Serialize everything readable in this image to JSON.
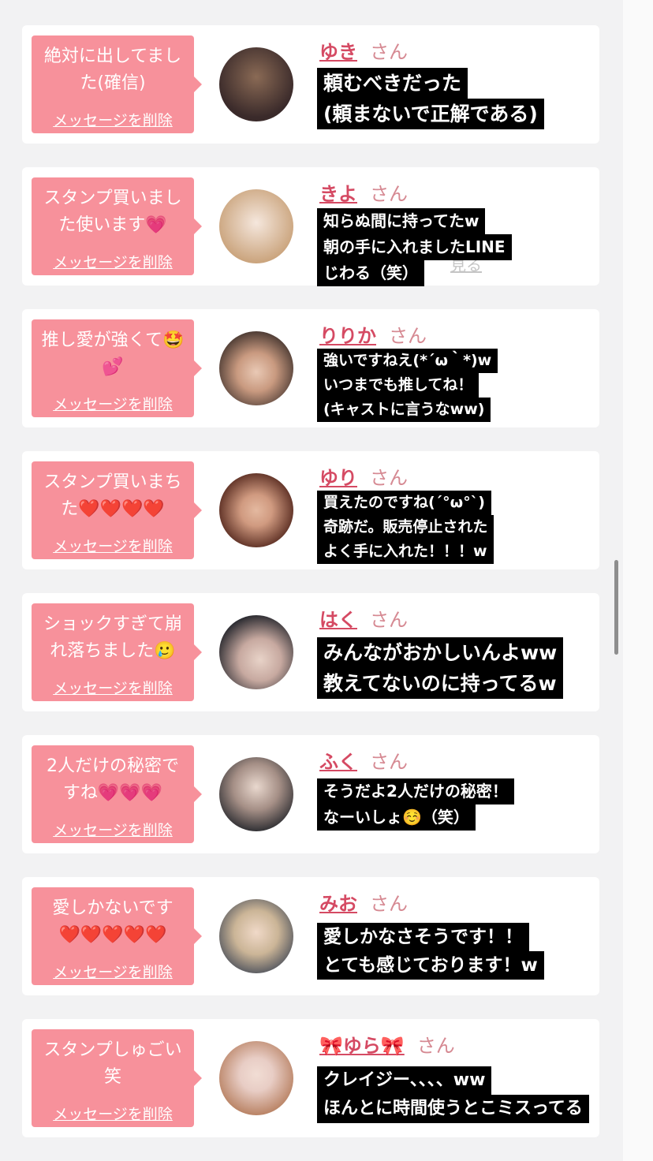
{
  "cards": [
    {
      "bubble_lines": [
        "絶対に出してまし",
        "た(確信)"
      ],
      "delete_label": "メッセージを削除",
      "name": "ゆき",
      "honorific": "さん",
      "overlay_lines": [
        "頼むべきだった",
        "(頼まないで正解である)"
      ],
      "avatar_colors": [
        "#3a2a2a",
        "#8a6a55"
      ]
    },
    {
      "bubble_lines": [
        "スタンプ買いまし",
        "た使います💗"
      ],
      "delete_label": "メッセージを削除",
      "name": "きよ",
      "honorific": "さん",
      "hidden_link": "見る",
      "overlay_lines": [
        "知らぬ間に持ってたw",
        "朝の手に入れましたLINE",
        "じわる（笑）"
      ],
      "avatar_colors": [
        "#f5e7dd",
        "#c9a27a"
      ]
    },
    {
      "bubble_lines": [
        "推し愛が強くて🤩",
        "💕"
      ],
      "delete_label": "メッセージを削除",
      "name": "りりか",
      "honorific": "さん",
      "overlay_lines": [
        "強いですねえ(*´ω｀*)w",
        "いつまでも推してね！",
        "(キャストに言うなww)"
      ],
      "avatar_colors": [
        "#4b3a33",
        "#c99a80"
      ]
    },
    {
      "bubble_lines": [
        "スタンプ買いまち",
        "た❤️❤️❤️❤️"
      ],
      "delete_label": "メッセージを削除",
      "name": "ゆり",
      "honorific": "さん",
      "overlay_lines": [
        "買えたのですね(´°ω°`)",
        "奇跡だ。販売停止された",
        "よく手に入れた！！！w"
      ],
      "avatar_colors": [
        "#5a2d22",
        "#d09a80"
      ]
    },
    {
      "bubble_lines": [
        "ショックすぎて崩",
        "れ落ちました🥲"
      ],
      "delete_label": "メッセージを削除",
      "name": "はく",
      "honorific": "さん",
      "overlay_lines": [
        "みんながおかしいんよww",
        "教えてないのに持ってるw"
      ],
      "avatar_colors": [
        "#2a2a30",
        "#e8d3c8"
      ]
    },
    {
      "bubble_lines": [
        "2人だけの秘密で",
        "すね💗💗💗"
      ],
      "delete_label": "メッセージを削除",
      "name": "ふく",
      "honorific": "さん",
      "overlay_lines": [
        "そうだよ2人だけの秘密！",
        "なーいしょ☺️（笑）"
      ],
      "avatar_colors": [
        "#d9cfc9",
        "#2f2f33"
      ]
    },
    {
      "bubble_lines": [
        "愛しかないです",
        "❤️❤️❤️❤️❤️"
      ],
      "delete_label": "メッセージを削除",
      "name": "みお",
      "honorific": "さん",
      "overlay_lines": [
        "愛しかなさそうです！！",
        "とても感じております！w"
      ],
      "avatar_colors": [
        "#cbb597",
        "#4a4f5a"
      ]
    },
    {
      "bubble_lines": [
        "スタンプしゅごい",
        "笑"
      ],
      "delete_label": "メッセージを削除",
      "name": "🎀ゆら🎀",
      "honorific": "さん",
      "overlay_lines": [
        "クレイジー、、、、ww",
        "ほんとに時間使うとこミスってる"
      ],
      "avatar_colors": [
        "#e8cdc5",
        "#b57c5c"
      ]
    }
  ]
}
